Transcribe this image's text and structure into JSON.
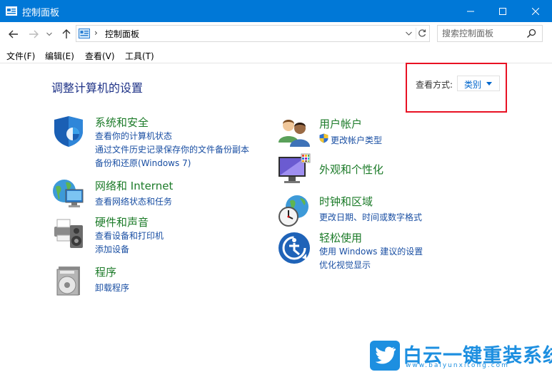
{
  "window": {
    "title": "控制面板",
    "icon": "control-panel-icon"
  },
  "address": {
    "breadcrumb": "控制面板",
    "separator": "›"
  },
  "search": {
    "placeholder": "搜索控制面板"
  },
  "menu": [
    "文件(F)",
    "编辑(E)",
    "查看(V)",
    "工具(T)"
  ],
  "main": {
    "heading": "调整计算机的设置",
    "view_by": {
      "label": "查看方式:",
      "selected": "类别"
    }
  },
  "categories": {
    "system": {
      "title": "系统和安全",
      "icon": "shield-icon",
      "links": [
        "查看你的计算机状态",
        "通过文件历史记录保存你的文件备份副本",
        "备份和还原(Windows 7)"
      ]
    },
    "network": {
      "title": "网络和 Internet",
      "icon": "network-globe-icon",
      "links": [
        "查看网络状态和任务"
      ]
    },
    "hardware": {
      "title": "硬件和声音",
      "icon": "printer-speaker-icon",
      "links": [
        "查看设备和打印机",
        "添加设备"
      ]
    },
    "programs": {
      "title": "程序",
      "icon": "programs-disc-icon",
      "links": [
        "卸载程序"
      ]
    },
    "users": {
      "title": "用户帐户",
      "icon": "users-icon",
      "links": [
        "更改帐户类型"
      ]
    },
    "appearance": {
      "title": "外观和个性化",
      "icon": "monitor-palette-icon",
      "links": []
    },
    "clock": {
      "title": "时钟和区域",
      "icon": "clock-globe-icon",
      "links": [
        "更改日期、时间或数字格式"
      ]
    },
    "ease": {
      "title": "轻松使用",
      "icon": "ease-of-access-icon",
      "links": [
        "使用 Windows 建议的设置",
        "优化视觉显示"
      ]
    }
  },
  "watermark": {
    "text": "白云一键重装系统",
    "url": "www.baiyunxitong.com"
  },
  "colors": {
    "titlebar": "#0078d7",
    "category_title": "#1c7b29",
    "link": "#1a4fa3",
    "highlight_box": "#e81123",
    "watermark": "#1d8fe0"
  }
}
